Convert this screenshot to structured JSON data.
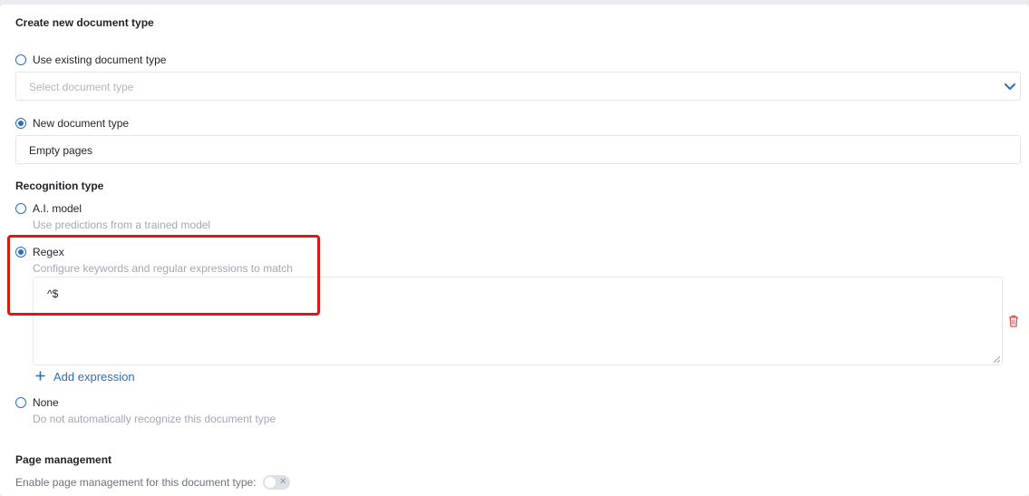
{
  "section_title": "Create new document type",
  "document_type_options": {
    "existing_label": "Use existing document type",
    "select_placeholder": "Select document type",
    "new_label": "New document type",
    "new_value": "Empty pages",
    "selected": "new"
  },
  "recognition": {
    "title": "Recognition type",
    "options": [
      {
        "label": "A.I. model",
        "description": "Use predictions from a trained model",
        "checked": false
      },
      {
        "label": "Regex",
        "description": "Configure keywords and regular expressions to match",
        "checked": true
      },
      {
        "label": "None",
        "description": "Do not automatically recognize this document type",
        "checked": false
      }
    ],
    "expression_value": "^$",
    "add_expression_label": "Add expression"
  },
  "page_management": {
    "title": "Page management",
    "enable_label": "Enable page management for this document type:",
    "enabled": false
  },
  "colors": {
    "accent": "#2f6db5",
    "danger": "#d9534f",
    "highlight": "#e01515"
  }
}
